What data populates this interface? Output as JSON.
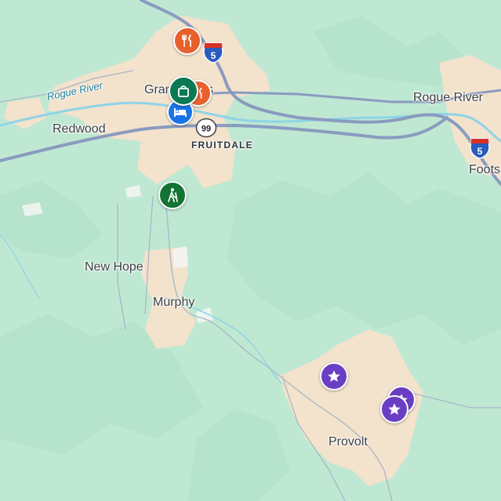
{
  "colors": {
    "forest": "#bfe8d3",
    "urban": "#f3e2cc",
    "water": "#8fd4e6",
    "highway": "#8a9bbf",
    "restaurant": "#e8612c",
    "shopping": "#0b7a52",
    "hiking": "#137333",
    "lodging": "#1a73e8",
    "attraction": "#6a3ec4"
  },
  "labels": {
    "grants_pass": "Grants Pass",
    "redwood": "Redwood",
    "fruitdale": "FRUITDALE",
    "rogue_river_water": "Rogue River",
    "rogue_river_town": "Rogue River",
    "foots": "Foots",
    "new_hope": "New Hope",
    "murphy": "Murphy",
    "provolt": "Provolt"
  },
  "shields": {
    "i5_north": "5",
    "i5_east": "5",
    "or99": "99"
  },
  "pois": [
    {
      "icon": "fork-knife-icon",
      "category": "restaurant"
    },
    {
      "icon": "shopping-bag-icon",
      "category": "shopping"
    },
    {
      "icon": "bed-icon",
      "category": "lodging"
    },
    {
      "icon": "hiker-icon",
      "category": "hiking"
    },
    {
      "icon": "star-icon",
      "category": "attraction"
    },
    {
      "icon": "star-icon",
      "category": "attraction"
    },
    {
      "icon": "star-icon",
      "category": "attraction"
    }
  ]
}
